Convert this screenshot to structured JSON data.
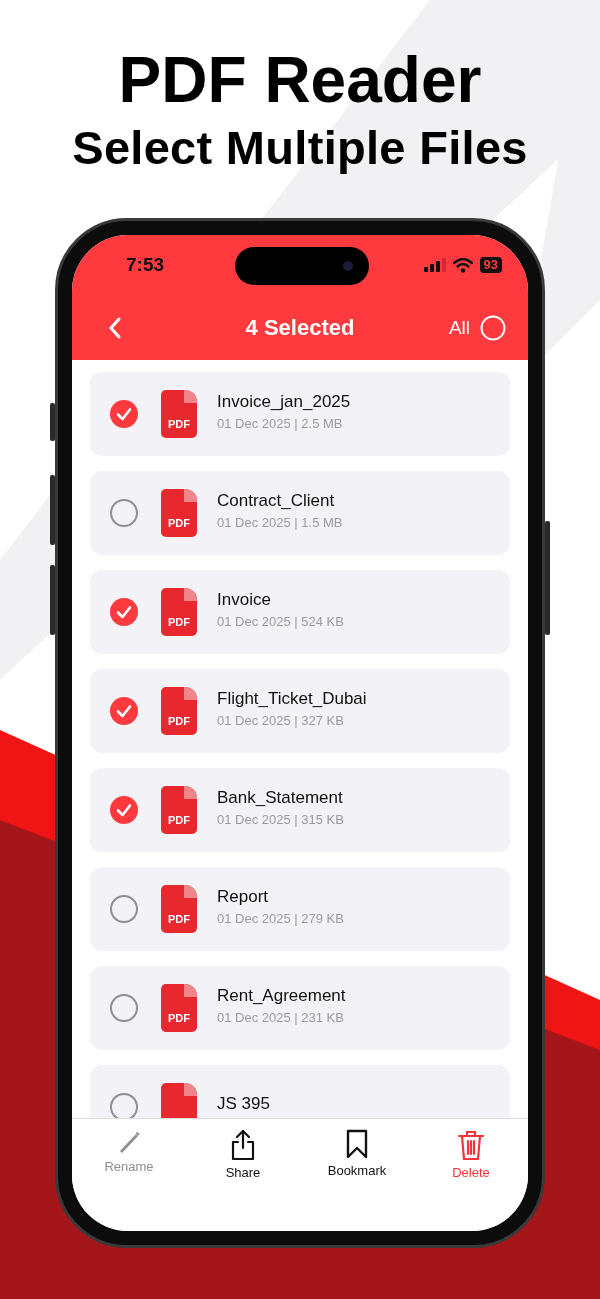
{
  "headline": {
    "title": "PDF Reader",
    "subtitle": "Select Multiple Files"
  },
  "status_bar": {
    "time": "7:53",
    "battery": "93"
  },
  "nav": {
    "title": "4 Selected",
    "select_all_label": "All",
    "all_selected": false
  },
  "files": [
    {
      "name": "Invoice_jan_2025",
      "meta": "01 Dec 2025 | 2.5 MB",
      "selected": true,
      "badge": "PDF"
    },
    {
      "name": "Contract_Client",
      "meta": "01 Dec 2025 | 1.5 MB",
      "selected": false,
      "badge": "PDF"
    },
    {
      "name": "Invoice",
      "meta": "01 Dec 2025 | 524 KB",
      "selected": true,
      "badge": "PDF"
    },
    {
      "name": "Flight_Ticket_Dubai",
      "meta": "01 Dec 2025 | 327 KB",
      "selected": true,
      "badge": "PDF"
    },
    {
      "name": "Bank_Statement",
      "meta": "01 Dec 2025 | 315 KB",
      "selected": true,
      "badge": "PDF"
    },
    {
      "name": "Report",
      "meta": "01 Dec 2025 | 279 KB",
      "selected": false,
      "badge": "PDF"
    },
    {
      "name": "Rent_Agreement",
      "meta": "01 Dec 2025 | 231 KB",
      "selected": false,
      "badge": "PDF"
    },
    {
      "name": "JS 395",
      "selected": false
    }
  ],
  "toolbar": [
    {
      "label": "Rename",
      "kind": "rename",
      "disabled": true,
      "destructive": false
    },
    {
      "label": "Share",
      "kind": "share",
      "disabled": false,
      "destructive": false
    },
    {
      "label": "Bookmark",
      "kind": "bookmark",
      "disabled": false,
      "destructive": false
    },
    {
      "label": "Delete",
      "kind": "delete",
      "disabled": false,
      "destructive": true
    }
  ]
}
